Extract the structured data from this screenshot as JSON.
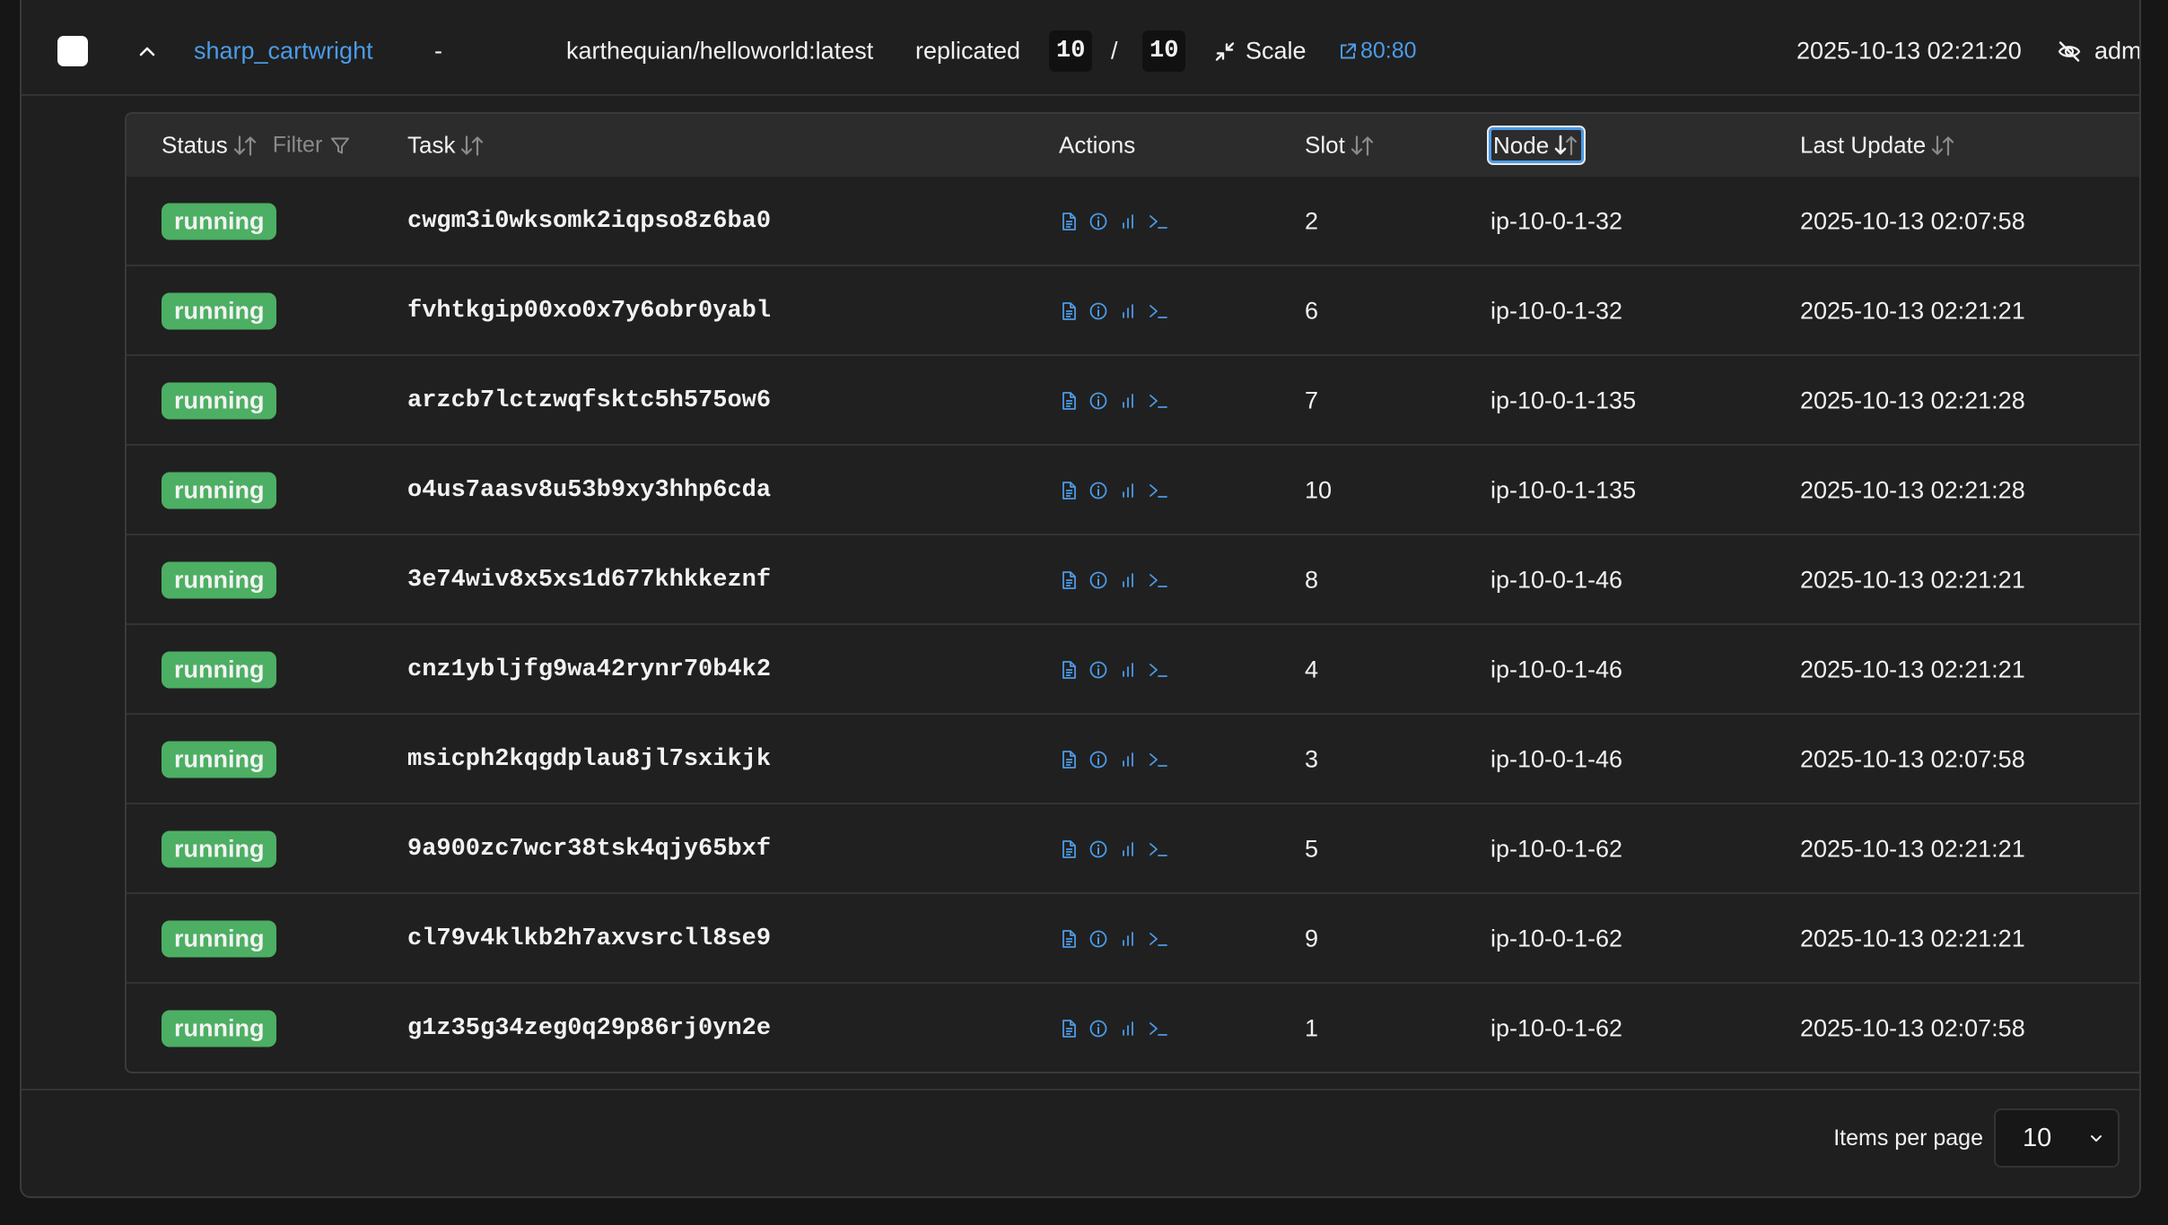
{
  "service": {
    "name": "sharp_cartwright",
    "dash": "-",
    "image": "karthequian/helloworld:latest",
    "mode": "replicated",
    "replicas_running": "10",
    "replicas_separator": "/",
    "replicas_desired": "10",
    "scale_label": "Scale",
    "port": "80:80",
    "updated": "2025-10-13 02:21:20",
    "user": "adm"
  },
  "table": {
    "headers": {
      "status": "Status",
      "filter": "Filter",
      "task": "Task",
      "actions": "Actions",
      "slot": "Slot",
      "node": "Node",
      "last_update": "Last Update"
    },
    "rows": [
      {
        "status": "running",
        "task": "cwgm3i0wksomk2iqpso8z6ba0",
        "slot": "2",
        "node": "ip-10-0-1-32",
        "last_update": "2025-10-13 02:07:58"
      },
      {
        "status": "running",
        "task": "fvhtkgip00xo0x7y6obr0yabl",
        "slot": "6",
        "node": "ip-10-0-1-32",
        "last_update": "2025-10-13 02:21:21"
      },
      {
        "status": "running",
        "task": "arzcb7lctzwqfsktc5h575ow6",
        "slot": "7",
        "node": "ip-10-0-1-135",
        "last_update": "2025-10-13 02:21:28"
      },
      {
        "status": "running",
        "task": "o4us7aasv8u53b9xy3hhp6cda",
        "slot": "10",
        "node": "ip-10-0-1-135",
        "last_update": "2025-10-13 02:21:28"
      },
      {
        "status": "running",
        "task": "3e74wiv8x5xs1d677khkkeznf",
        "slot": "8",
        "node": "ip-10-0-1-46",
        "last_update": "2025-10-13 02:21:21"
      },
      {
        "status": "running",
        "task": "cnz1ybljfg9wa42rynr70b4k2",
        "slot": "4",
        "node": "ip-10-0-1-46",
        "last_update": "2025-10-13 02:21:21"
      },
      {
        "status": "running",
        "task": "msicph2kqgdplau8jl7sxikjk",
        "slot": "3",
        "node": "ip-10-0-1-46",
        "last_update": "2025-10-13 02:07:58"
      },
      {
        "status": "running",
        "task": "9a900zc7wcr38tsk4qjy65bxf",
        "slot": "5",
        "node": "ip-10-0-1-62",
        "last_update": "2025-10-13 02:21:21"
      },
      {
        "status": "running",
        "task": "cl79v4klkb2h7axvsrcll8se9",
        "slot": "9",
        "node": "ip-10-0-1-62",
        "last_update": "2025-10-13 02:21:21"
      },
      {
        "status": "running",
        "task": "g1z35g34zeg0q29p86rj0yn2e",
        "slot": "1",
        "node": "ip-10-0-1-62",
        "last_update": "2025-10-13 02:07:58"
      }
    ],
    "row_actions": [
      "logs-icon",
      "info-icon",
      "stats-icon",
      "console-icon"
    ]
  },
  "pagination": {
    "label": "Items per page",
    "value": "10"
  },
  "colors": {
    "accent": "#4c9be8",
    "status_running": "#4caf63",
    "background": "#1f1f1f",
    "header_bg": "#2c2c2c"
  }
}
